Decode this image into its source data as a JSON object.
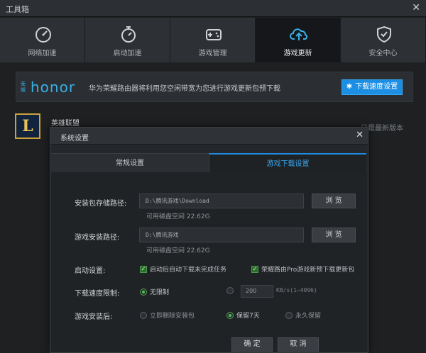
{
  "window": {
    "title": "工具箱",
    "close_glyph": "✕"
  },
  "tabs": [
    {
      "label": "网络加速",
      "icon": "speedometer-icon"
    },
    {
      "label": "启动加速",
      "icon": "stopwatch-icon"
    },
    {
      "label": "游戏管理",
      "icon": "gamepad-icon"
    },
    {
      "label": "游戏更新",
      "icon": "cloud-upload-icon",
      "active": true
    },
    {
      "label": "安全中心",
      "icon": "shield-check-icon"
    }
  ],
  "banner": {
    "logo_small": "荣耀",
    "logo_text": "honor",
    "description": "华为荣耀路由器将利用您空闲带宽为您进行游戏更新包预下载",
    "speed_button": "下载速度设置"
  },
  "game": {
    "icon_letter": "L",
    "name": "英雄联盟",
    "status": "已是最新版本"
  },
  "dialog": {
    "title": "系统设置",
    "close_glyph": "✕",
    "tabs": [
      "常规设置",
      "游戏下载设置"
    ],
    "package_path": {
      "label": "安装包存储路径:",
      "value": "D:\\腾讯游戏\\Download",
      "browse": "浏 览",
      "space": "可用磁盘空间 22.62G"
    },
    "install_path": {
      "label": "游戏安装路径:",
      "value": "D:\\腾讯游戏",
      "browse": "浏 览",
      "space": "可用磁盘空间 22.62G"
    },
    "startup": {
      "label": "启动设置:",
      "opt1": "启动后自动下载未完成任务",
      "opt2": "荣耀路由Pro游戏新预下载更新包"
    },
    "speed_limit": {
      "label": "下载速度限制:",
      "opt_unlimited": "无限制",
      "value": "200",
      "unit": "KB/s(1~4096)"
    },
    "after_install": {
      "label": "游戏安装后:",
      "opt1": "立即删除安装包",
      "opt2": "保留7天",
      "opt3": "永久保留"
    },
    "ok": "确 定",
    "cancel": "取 消"
  },
  "colors": {
    "accent": "#1c8ee3",
    "honor_blue": "#3ab0e6",
    "check_green": "#4fbf55"
  }
}
